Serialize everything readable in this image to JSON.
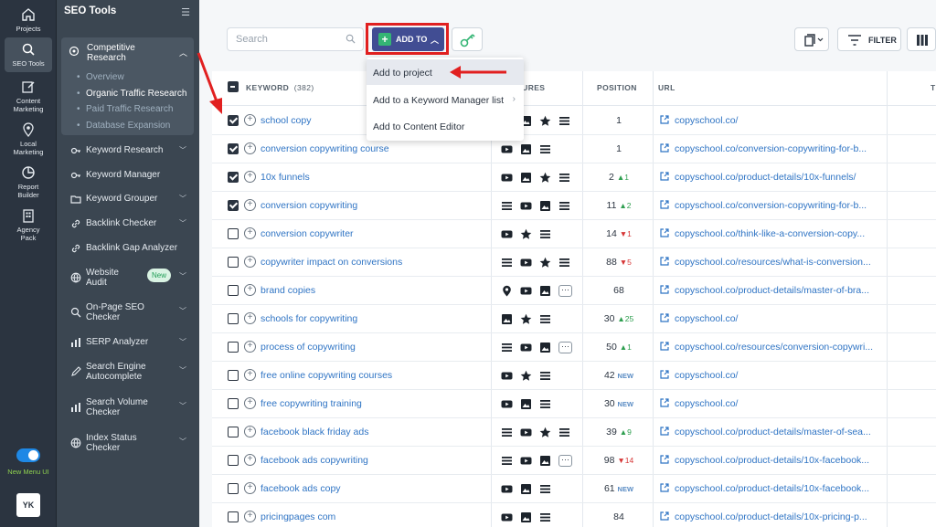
{
  "rail": {
    "items": [
      {
        "label": "Projects",
        "icon": "home-icon"
      },
      {
        "label": "SEO Tools",
        "icon": "search-icon"
      },
      {
        "label": "Content Marketing",
        "icon": "edit-icon"
      },
      {
        "label": "Local Marketing",
        "icon": "pin-icon"
      },
      {
        "label": "Report Builder",
        "icon": "pie-chart-icon"
      },
      {
        "label": "Agency Pack",
        "icon": "building-icon"
      }
    ],
    "toggle_label": "New Menu UI",
    "avatar": "YK"
  },
  "sidebar": {
    "title": "SEO Tools",
    "active_section": "Competitive Research",
    "sub_items": [
      "Overview",
      "Organic Traffic Research",
      "Paid Traffic Research",
      "Database Expansion"
    ],
    "items": [
      {
        "label": "Keyword Research",
        "caret": true
      },
      {
        "label": "Keyword Manager",
        "caret": false
      },
      {
        "label": "Keyword Grouper",
        "caret": true
      },
      {
        "label": "Backlink Checker",
        "caret": true
      },
      {
        "label": "Backlink Gap Analyzer",
        "caret": false
      },
      {
        "label": "Website Audit",
        "caret": true,
        "badge": "New"
      },
      {
        "label": "On-Page SEO Checker",
        "caret": true
      },
      {
        "label": "SERP Analyzer",
        "caret": true
      },
      {
        "label": "Search Engine Autocomplete",
        "caret": true
      },
      {
        "label": "Search Volume Checker",
        "caret": true
      },
      {
        "label": "Index Status Checker",
        "caret": true
      }
    ]
  },
  "toolbar": {
    "search_placeholder": "Search",
    "add_to_label": "ADD TO",
    "filter_label": "FILTER"
  },
  "dropdown": {
    "items": [
      "Add to project",
      "Add to a Keyword Manager list",
      "Add to Content Editor"
    ]
  },
  "table": {
    "headers": {
      "keyword": "KEYWORD",
      "keyword_count": "(382)",
      "features": "FEATURES",
      "position": "POSITION",
      "url": "URL",
      "extra": "T"
    },
    "rows": [
      {
        "checked": true,
        "keyword": "school copy",
        "features": [
          "youtube",
          "image",
          "star",
          "list"
        ],
        "position": "1",
        "change": "",
        "change_type": "",
        "url": "copyschool.co/"
      },
      {
        "checked": true,
        "keyword": "conversion copywriting course",
        "features": [
          "youtube",
          "image",
          "list"
        ],
        "position": "1",
        "change": "",
        "change_type": "",
        "url": "copyschool.co/conversion-copywriting-for-b..."
      },
      {
        "checked": true,
        "keyword": "10x funnels",
        "features": [
          "youtube",
          "image",
          "star",
          "list"
        ],
        "position": "2",
        "change": "▲1",
        "change_type": "up",
        "url": "copyschool.co/product-details/10x-funnels/"
      },
      {
        "checked": true,
        "keyword": "conversion copywriting",
        "features": [
          "list",
          "youtube",
          "image",
          "list"
        ],
        "position": "11",
        "change": "▲2",
        "change_type": "up",
        "url": "copyschool.co/conversion-copywriting-for-b..."
      },
      {
        "checked": false,
        "keyword": "conversion copywriter",
        "features": [
          "youtube",
          "star",
          "list"
        ],
        "position": "14",
        "change": "▼1",
        "change_type": "down",
        "url": "copyschool.co/think-like-a-conversion-copy..."
      },
      {
        "checked": false,
        "keyword": "copywriter impact on conversions",
        "features": [
          "list",
          "youtube",
          "star",
          "list"
        ],
        "position": "88",
        "change": "▼5",
        "change_type": "down",
        "url": "copyschool.co/resources/what-is-conversion..."
      },
      {
        "checked": false,
        "keyword": "brand copies",
        "features": [
          "pin",
          "youtube",
          "image",
          "more"
        ],
        "position": "68",
        "change": "",
        "change_type": "",
        "url": "copyschool.co/product-details/master-of-bra..."
      },
      {
        "checked": false,
        "keyword": "schools for copywriting",
        "features": [
          "image",
          "star",
          "list"
        ],
        "position": "30",
        "change": "▲25",
        "change_type": "up",
        "url": "copyschool.co/"
      },
      {
        "checked": false,
        "keyword": "process of copywriting",
        "features": [
          "list",
          "youtube",
          "image",
          "more"
        ],
        "position": "50",
        "change": "▲1",
        "change_type": "up",
        "url": "copyschool.co/resources/conversion-copywri..."
      },
      {
        "checked": false,
        "keyword": "free online copywriting courses",
        "features": [
          "youtube",
          "star",
          "list"
        ],
        "position": "42",
        "change": "NEW",
        "change_type": "new",
        "url": "copyschool.co/"
      },
      {
        "checked": false,
        "keyword": "free copywriting training",
        "features": [
          "youtube",
          "image",
          "list"
        ],
        "position": "30",
        "change": "NEW",
        "change_type": "new",
        "url": "copyschool.co/"
      },
      {
        "checked": false,
        "keyword": "facebook black friday ads",
        "features": [
          "list",
          "youtube",
          "star",
          "list"
        ],
        "position": "39",
        "change": "▲9",
        "change_type": "up",
        "url": "copyschool.co/product-details/master-of-sea..."
      },
      {
        "checked": false,
        "keyword": "facebook ads copywriting",
        "features": [
          "list",
          "youtube",
          "image",
          "more"
        ],
        "position": "98",
        "change": "▼14",
        "change_type": "down",
        "url": "copyschool.co/product-details/10x-facebook..."
      },
      {
        "checked": false,
        "keyword": "facebook ads copy",
        "features": [
          "youtube",
          "image",
          "list"
        ],
        "position": "61",
        "change": "NEW",
        "change_type": "new",
        "url": "copyschool.co/product-details/10x-facebook..."
      },
      {
        "checked": false,
        "keyword": "pricingpages com",
        "features": [
          "youtube",
          "image",
          "list"
        ],
        "position": "84",
        "change": "",
        "change_type": "",
        "url": "copyschool.co/product-details/10x-pricing-p..."
      }
    ]
  },
  "colors": {
    "rail_bg": "#2b3440",
    "sidebar_bg": "#3b4651",
    "accent_button": "#414d93",
    "link": "#2f74c4",
    "highlight_red": "#e12020",
    "up": "#2e9e4f",
    "down": "#d63636"
  }
}
